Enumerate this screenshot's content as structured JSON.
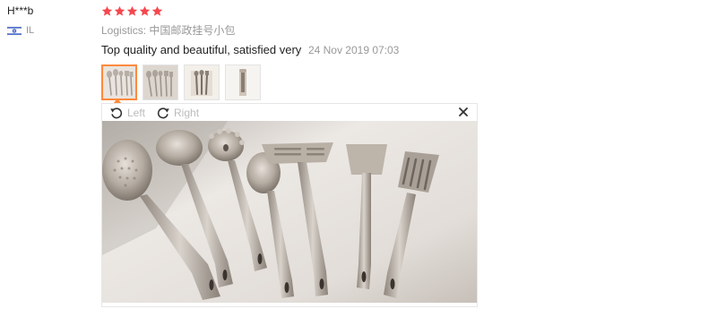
{
  "reviewer": {
    "name": "H***b",
    "country_code": "IL"
  },
  "review": {
    "rating": 5,
    "rating_max": 5,
    "logistics": "Logistics: 中国邮政挂号小包",
    "comment": "Top quality and beautiful, satisfied very",
    "date": "24 Nov 2019 07:03",
    "thumbnail_count": 4,
    "active_thumbnail": 1
  },
  "viewer": {
    "rotate_left_label": "Left",
    "rotate_right_label": "Right",
    "close_symbol": "×"
  },
  "colors": {
    "star": "#f5474e",
    "thumb_active_border": "#ff8a3d",
    "muted_text": "#999999"
  },
  "icons": [
    "israel-flag-icon",
    "star-icon",
    "rotate-left-icon",
    "rotate-right-icon",
    "close-icon"
  ]
}
